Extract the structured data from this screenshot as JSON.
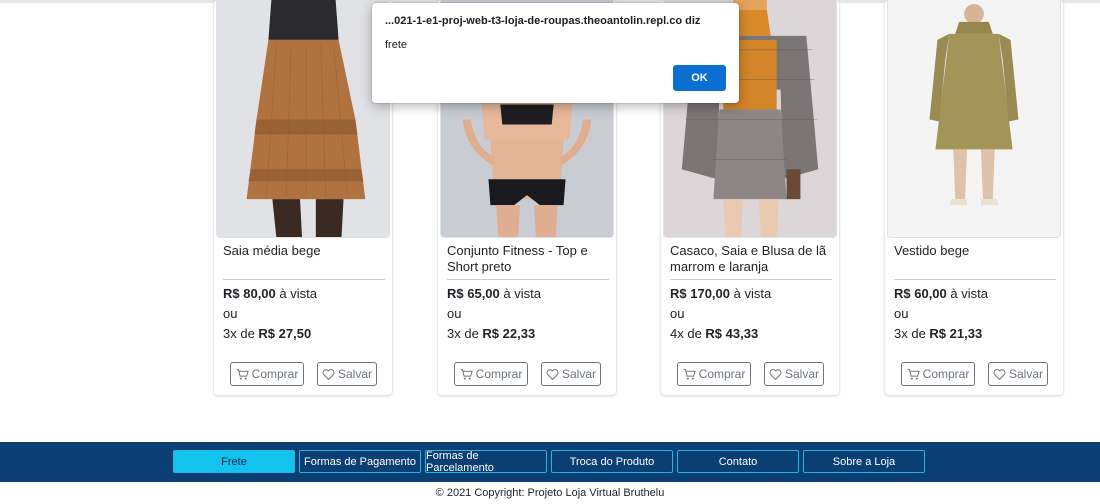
{
  "dialog": {
    "title": "...021-1-e1-proj-web-t3-loja-de-roupas.theoantolin.repl.co diz",
    "message": "frete",
    "ok_label": "OK",
    "button_color": "#0b6fd1"
  },
  "products": [
    {
      "title": "Saia média bege",
      "price": "R$ 80,00",
      "price_suffix": " à vista",
      "or": "ou",
      "inst_prefix": "3x de ",
      "inst_value": "R$ 27,50",
      "buy_label": "Comprar",
      "save_label": "Salvar"
    },
    {
      "title": "Conjunto Fitness - Top e Short preto",
      "price": "R$ 65,00",
      "price_suffix": " à vista",
      "or": "ou",
      "inst_prefix": "3x de ",
      "inst_value": "R$ 22,33",
      "buy_label": "Comprar",
      "save_label": "Salvar"
    },
    {
      "title": "Casaco, Saia e Blusa de lã marrom e laranja",
      "price": "R$ 170,00",
      "price_suffix": " à vista",
      "or": "ou",
      "inst_prefix": "4x de ",
      "inst_value": "R$ 43,33",
      "buy_label": "Comprar",
      "save_label": "Salvar"
    },
    {
      "title": "Vestido bege",
      "price": "R$ 60,00",
      "price_suffix": " à vista",
      "or": "ou",
      "inst_prefix": "3x de ",
      "inst_value": "R$ 21,33",
      "buy_label": "Comprar",
      "save_label": "Salvar"
    }
  ],
  "footer": {
    "nav": [
      "Frete",
      "Formas de Pagamento",
      "Formas de Parcelamento",
      "Troca do Produto",
      "Contato",
      "Sobre a Loja"
    ],
    "active_index": 0,
    "copyright": "© 2021 Copyright: Projeto Loja Virtual Bruthelu",
    "bg_color": "#0b3f74",
    "accent_color": "#12c3ee"
  }
}
